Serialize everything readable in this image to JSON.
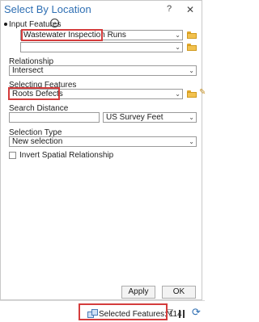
{
  "dialog": {
    "title": "Select By Location",
    "help_label": "?",
    "close_label": "✕"
  },
  "input_features": {
    "label": "Input Features",
    "value": "Wastewater Inspection Runs",
    "second_value": ""
  },
  "relationship": {
    "label": "Relationship",
    "value": "Intersect"
  },
  "selecting_features": {
    "label": "Selecting Features",
    "value": "Roots Defects"
  },
  "search_distance": {
    "label": "Search Distance",
    "value": "",
    "unit": "US Survey Feet"
  },
  "selection_type": {
    "label": "Selection Type",
    "value": "New selection"
  },
  "invert": {
    "label": "Invert Spatial Relationship",
    "checked": false
  },
  "buttons": {
    "apply": "Apply",
    "ok": "OK"
  },
  "status": {
    "selected_label": "Selected Features: 114"
  },
  "colors": {
    "highlight": "#d43c3c",
    "title_blue": "#2f6fb3"
  }
}
